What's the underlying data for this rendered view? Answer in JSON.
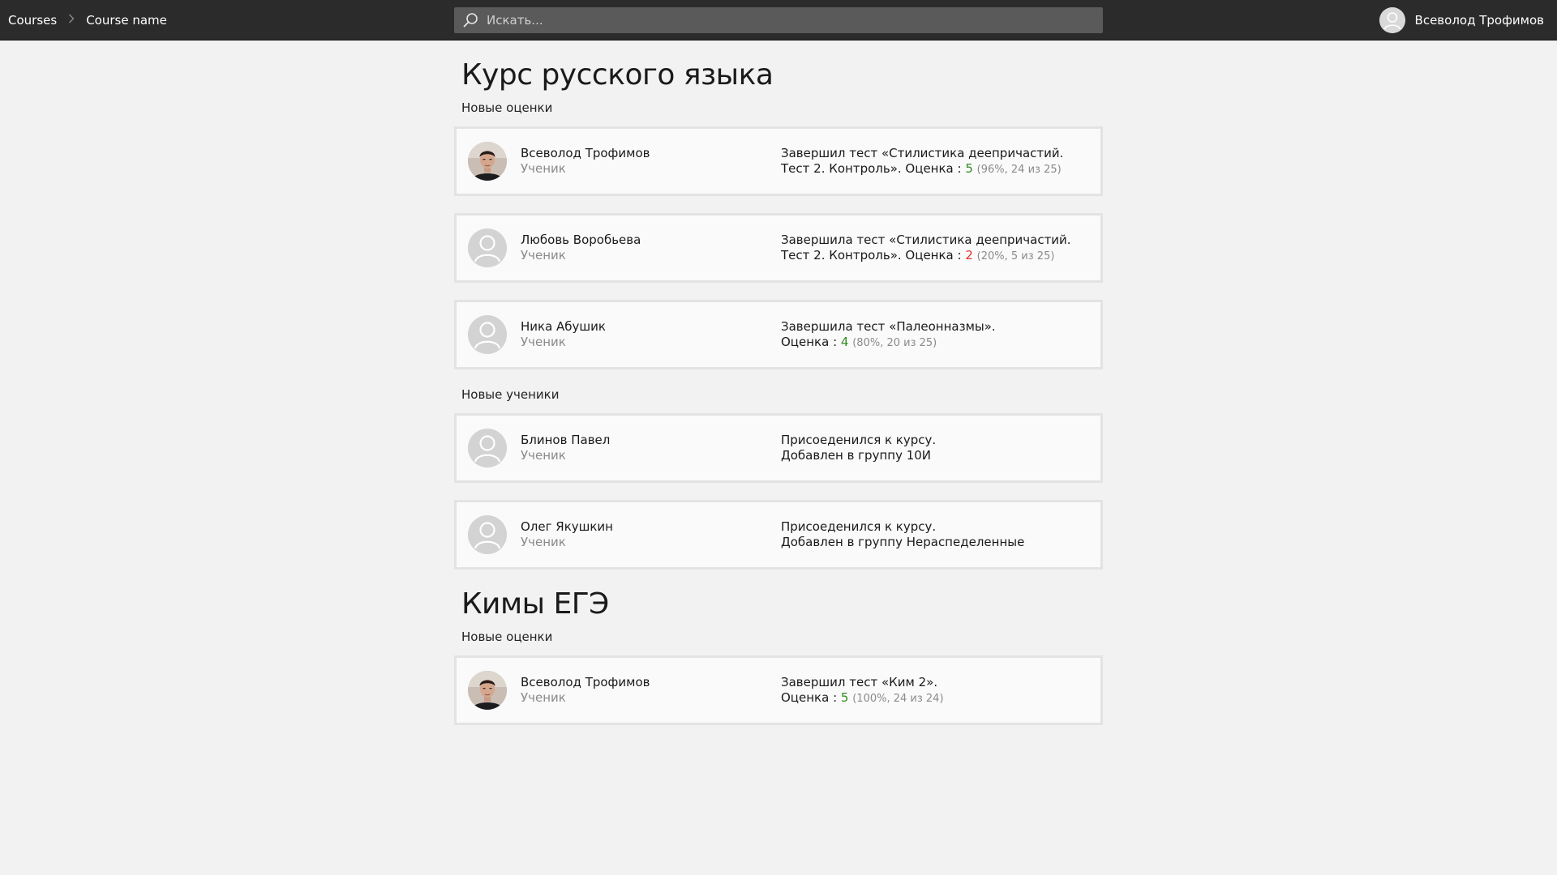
{
  "topbar": {
    "breadcrumb": [
      "Courses",
      "Course name"
    ],
    "search_placeholder": "Искать...",
    "user_name": "Всеволод Трофимов"
  },
  "courses": [
    {
      "title": "Курс русского языка",
      "sections": [
        {
          "label": "Новые оценки",
          "items": [
            {
              "name": "Всеволод Трофимов",
              "role": "Ученик",
              "avatar": "photo",
              "line1": "Завершил тест «Стилистика деепричастий.",
              "line2": "Тест 2. Контроль». Оценка : ",
              "grade": "5",
              "grade_color": "#2e8b1f",
              "detail": "(96%, 24 из 25)"
            },
            {
              "name": "Любовь Воробьева",
              "role": "Ученик",
              "avatar": "placeholder",
              "line1": "Завершила тест «Стилистика деепричастий.",
              "line2": "Тест 2. Контроль». Оценка : ",
              "grade": "2",
              "grade_color": "#e03030",
              "detail": "(20%, 5 из 25)"
            },
            {
              "name": "Ника Абушик",
              "role": "Ученик",
              "avatar": "placeholder",
              "line1": "Завершила тест «Палеонназмы».",
              "line2": "Оценка : ",
              "grade": "4",
              "grade_color": "#2e8b1f",
              "detail": "(80%, 20 из 25)"
            }
          ]
        },
        {
          "label": "Новые ученики",
          "items": [
            {
              "name": "Блинов Павел",
              "role": "Ученик",
              "avatar": "placeholder",
              "line1": "Присоеденился к курсу.",
              "line2": "Добавлен в группу 10И"
            },
            {
              "name": "Олег Якушкин",
              "role": "Ученик",
              "avatar": "placeholder",
              "line1": "Присоеденился к курсу.",
              "line2": "Добавлен в группу Нераспеделенные"
            }
          ]
        }
      ]
    },
    {
      "title": "Кимы ЕГЭ",
      "sections": [
        {
          "label": "Новые оценки",
          "items": [
            {
              "name": "Всеволод Трофимов",
              "role": "Ученик",
              "avatar": "photo",
              "line1": "Завершил тест «Ким 2».",
              "line2": "Оценка : ",
              "grade": "5",
              "grade_color": "#2e8b1f",
              "detail": "(100%, 24 из 24)"
            }
          ]
        }
      ]
    }
  ]
}
